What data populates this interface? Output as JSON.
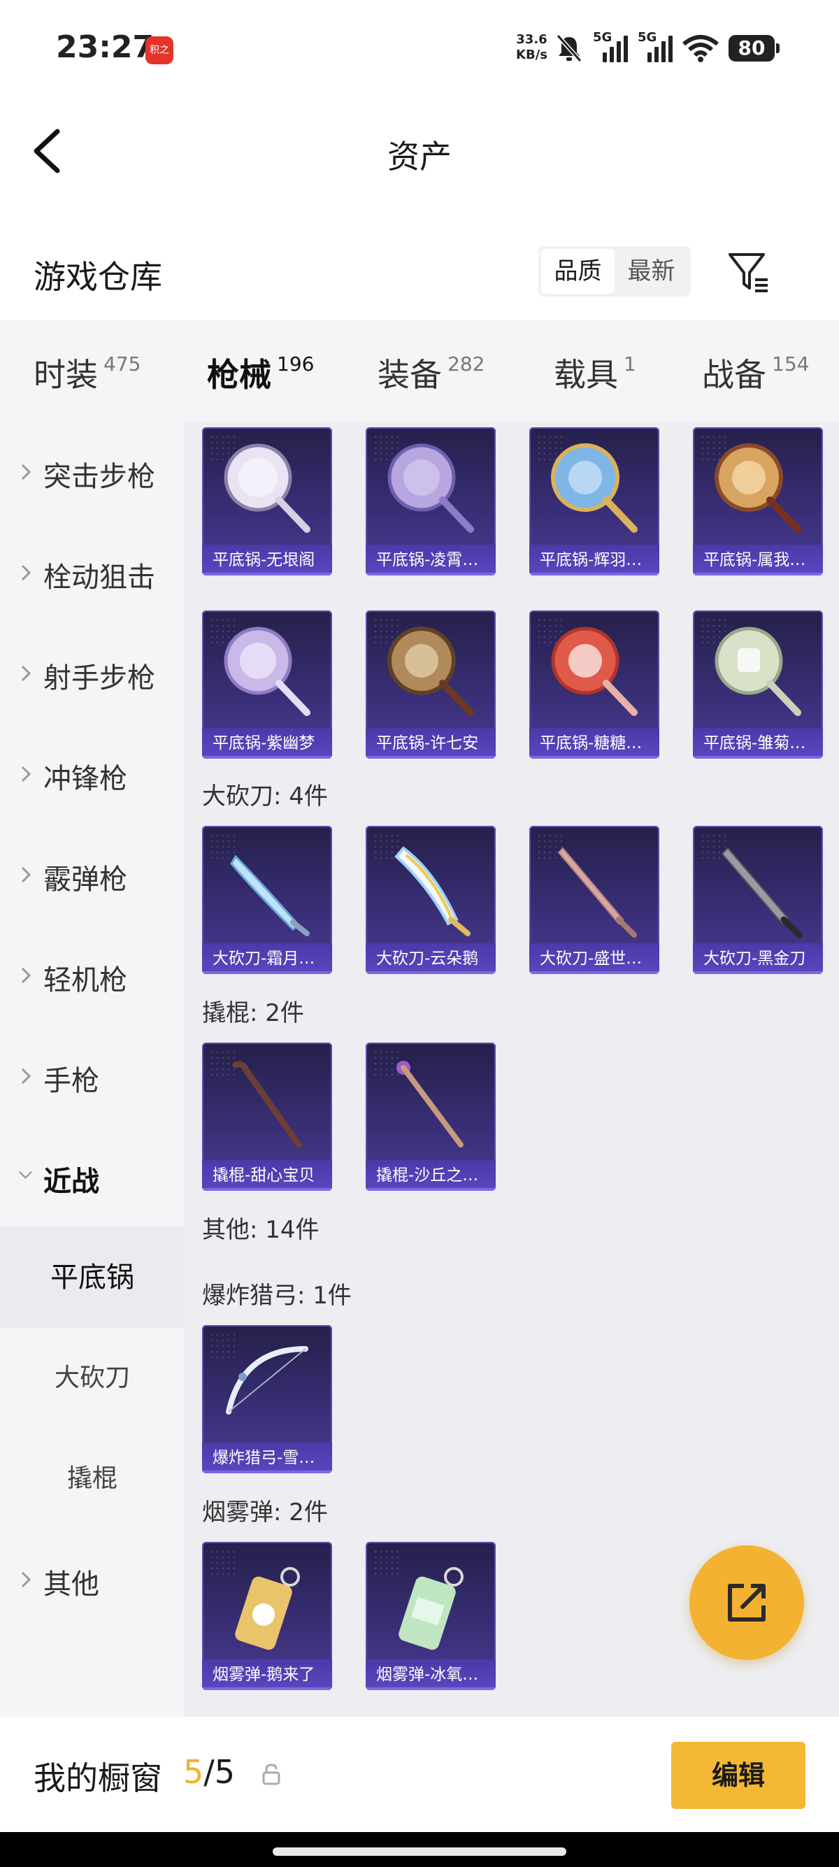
{
  "status_bar": {
    "time": "23:27",
    "app_badge": "积之",
    "net_speed_value": "33.6",
    "net_speed_unit": "KB/s",
    "signal_label_1": "5G",
    "signal_label_2": "5G",
    "battery": "80"
  },
  "header": {
    "title": "资产",
    "back_icon": "chevron-left-icon"
  },
  "warehouse": {
    "title": "游戏仓库",
    "sort_options": [
      "品质",
      "最新"
    ],
    "sort_selected": "品质",
    "filter_icon": "filter-icon"
  },
  "tabs": [
    {
      "label": "时装",
      "count": "475"
    },
    {
      "label": "枪械",
      "count": "196"
    },
    {
      "label": "装备",
      "count": "282"
    },
    {
      "label": "载具",
      "count": "1"
    },
    {
      "label": "战备",
      "count": "154"
    }
  ],
  "active_tab": "枪械",
  "sidebar": {
    "items": [
      {
        "label": "突击步枪"
      },
      {
        "label": "栓动狙击"
      },
      {
        "label": "射手步枪"
      },
      {
        "label": "冲锋枪"
      },
      {
        "label": "霰弹枪"
      },
      {
        "label": "轻机枪"
      },
      {
        "label": "手枪"
      },
      {
        "label": "近战"
      }
    ],
    "sub_items": [
      {
        "label": "平底锅"
      },
      {
        "label": "大砍刀"
      },
      {
        "label": "撬棍"
      }
    ],
    "active_sub": "平底锅",
    "last_item": {
      "label": "其他"
    }
  },
  "content": {
    "pans": [
      {
        "name": "平底锅-无垠阁",
        "color": "#e9e3f4"
      },
      {
        "name": "平底锅-凌霄…",
        "color": "#b7a6e0"
      },
      {
        "name": "平底锅-辉羽…",
        "color": "#7fb6e6"
      },
      {
        "name": "平底锅-属我…",
        "color": "#d9a460"
      },
      {
        "name": "平底锅-紫幽梦",
        "color": "#c9b8e8"
      },
      {
        "name": "平底锅-许七安",
        "color": "#b08a5a"
      },
      {
        "name": "平底锅-糖糖…",
        "color": "#e05a4a"
      },
      {
        "name": "平底锅-雏菊…",
        "color": "#d8e2c8"
      }
    ],
    "sections": [
      {
        "label": "大砍刀: 4件",
        "items": [
          {
            "name": "大砍刀-霜月…"
          },
          {
            "name": "大砍刀-云朵鹅"
          },
          {
            "name": "大砍刀-盛世…"
          },
          {
            "name": "大砍刀-黑金刀"
          }
        ]
      },
      {
        "label": "撬棍: 2件",
        "items": [
          {
            "name": "撬棍-甜心宝贝"
          },
          {
            "name": "撬棍-沙丘之…"
          }
        ]
      },
      {
        "label": "其他: 14件",
        "items": []
      },
      {
        "label": "爆炸猎弓: 1件",
        "items": [
          {
            "name": "爆炸猎弓-雪…"
          }
        ]
      },
      {
        "label": "烟雾弹: 2件",
        "items": [
          {
            "name": "烟雾弹-鹅来了"
          },
          {
            "name": "烟雾弹-冰氧…"
          }
        ]
      }
    ]
  },
  "fab": {
    "icon": "share-external-icon",
    "color": "#f4b232"
  },
  "showcase": {
    "label": "我的橱窗",
    "count_current": "5",
    "count_sep": "/",
    "count_total": "5",
    "lock_icon": "lock-icon",
    "edit_label": "编辑"
  },
  "colors": {
    "accent": "#f4b834",
    "card_bg": "#3a2f78",
    "tab_underline": "#f5b531"
  }
}
